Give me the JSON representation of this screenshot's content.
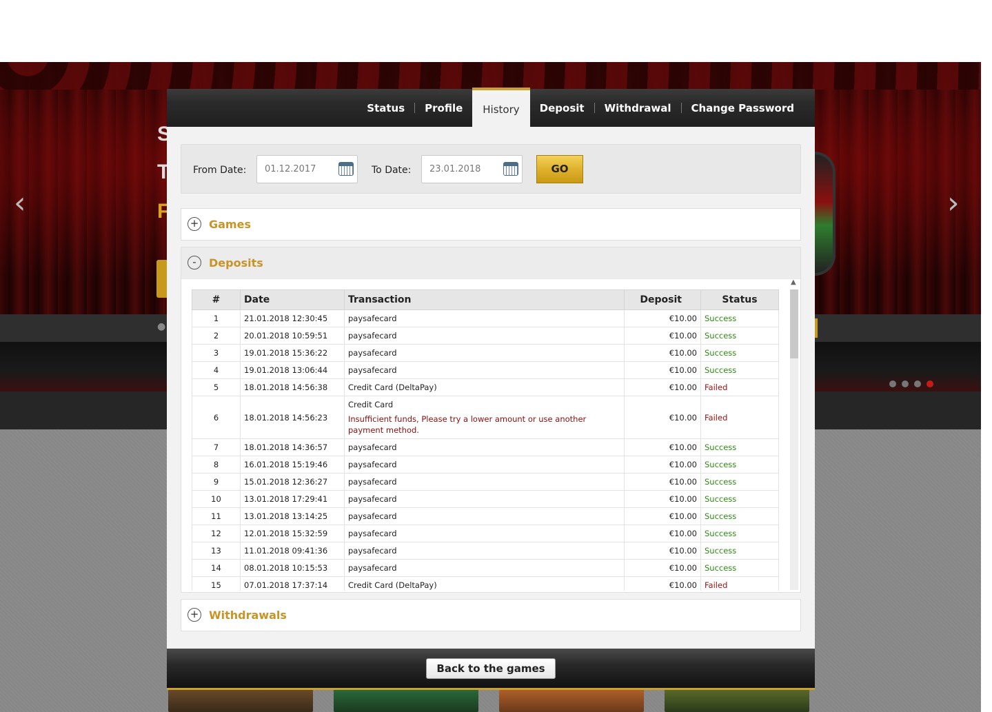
{
  "background": {
    "hero_lines": [
      "S",
      "T",
      "F"
    ],
    "prev_arrow": "‹",
    "next_arrow": "›"
  },
  "tabs": [
    {
      "label": "Status"
    },
    {
      "label": "Profile"
    },
    {
      "label": "History",
      "active": true
    },
    {
      "label": "Deposit"
    },
    {
      "label": "Withdrawal"
    },
    {
      "label": "Change Password"
    }
  ],
  "filter": {
    "from_label": "From Date:",
    "from_value": "01.12.2017",
    "to_label": "To Date:",
    "to_value": "23.01.2018",
    "go_label": "GO"
  },
  "sections": {
    "games": {
      "title": "Games",
      "toggle": "+"
    },
    "deposits": {
      "title": "Deposits",
      "toggle": "-"
    },
    "withdrawals": {
      "title": "Withdrawals",
      "toggle": "+"
    }
  },
  "deposits_table": {
    "headers": [
      "#",
      "Date",
      "Transaction",
      "Deposit",
      "Status"
    ],
    "rows": [
      {
        "n": "1",
        "date": "21.01.2018 12:30:45",
        "tx": "paysafecard",
        "error": "",
        "amount": "€10.00",
        "status": "Success"
      },
      {
        "n": "2",
        "date": "20.01.2018 10:59:51",
        "tx": "paysafecard",
        "error": "",
        "amount": "€10.00",
        "status": "Success"
      },
      {
        "n": "3",
        "date": "19.01.2018 15:36:22",
        "tx": "paysafecard",
        "error": "",
        "amount": "€10.00",
        "status": "Success"
      },
      {
        "n": "4",
        "date": "19.01.2018 13:06:44",
        "tx": "paysafecard",
        "error": "",
        "amount": "€10.00",
        "status": "Success"
      },
      {
        "n": "5",
        "date": "18.01.2018 14:56:38",
        "tx": "Credit Card (DeltaPay)",
        "error": "",
        "amount": "€10.00",
        "status": "Failed"
      },
      {
        "n": "6",
        "date": "18.01.2018 14:56:23",
        "tx": "Credit Card",
        "error": "Insufficient funds, Please try a lower amount or use another payment method.",
        "amount": "€10.00",
        "status": "Failed"
      },
      {
        "n": "7",
        "date": "18.01.2018 14:36:57",
        "tx": "paysafecard",
        "error": "",
        "amount": "€10.00",
        "status": "Success"
      },
      {
        "n": "8",
        "date": "16.01.2018 15:19:46",
        "tx": "paysafecard",
        "error": "",
        "amount": "€10.00",
        "status": "Success"
      },
      {
        "n": "9",
        "date": "15.01.2018 12:36:27",
        "tx": "paysafecard",
        "error": "",
        "amount": "€10.00",
        "status": "Success"
      },
      {
        "n": "10",
        "date": "13.01.2018 17:29:41",
        "tx": "paysafecard",
        "error": "",
        "amount": "€10.00",
        "status": "Success"
      },
      {
        "n": "11",
        "date": "13.01.2018 13:14:25",
        "tx": "paysafecard",
        "error": "",
        "amount": "€10.00",
        "status": "Success"
      },
      {
        "n": "12",
        "date": "12.01.2018 15:32:59",
        "tx": "paysafecard",
        "error": "",
        "amount": "€10.00",
        "status": "Success"
      },
      {
        "n": "13",
        "date": "11.01.2018 09:41:36",
        "tx": "paysafecard",
        "error": "",
        "amount": "€10.00",
        "status": "Success"
      },
      {
        "n": "14",
        "date": "08.01.2018 10:15:53",
        "tx": "paysafecard",
        "error": "",
        "amount": "€10.00",
        "status": "Success"
      },
      {
        "n": "15",
        "date": "07.01.2018 17:37:14",
        "tx": "Credit Card (DeltaPay)",
        "error": "",
        "amount": "€10.00",
        "status": "Failed"
      }
    ]
  },
  "footer": {
    "back_label": "Back to the games"
  },
  "colors": {
    "accent": "#c99425",
    "success": "#2e8b12",
    "failed": "#a11313",
    "tab_active_border": "#c9a133"
  }
}
